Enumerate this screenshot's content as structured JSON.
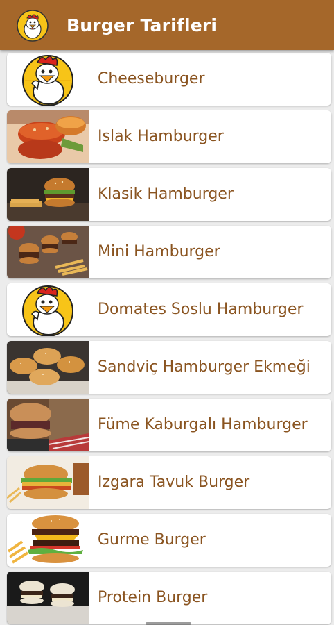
{
  "app": {
    "title": "Burger Tarifleri",
    "logo_icon": "chicken-chef-logo-icon",
    "bar_color": "#a5672a",
    "text_color": "#8a5420"
  },
  "recipes": [
    {
      "label": "Cheeseburger",
      "thumb": "chicken-chef-logo"
    },
    {
      "label": "Islak Hamburger",
      "thumb": "wet-burger-photo"
    },
    {
      "label": "Klasik Hamburger",
      "thumb": "classic-burger-photo"
    },
    {
      "label": "Mini Hamburger",
      "thumb": "mini-burgers-photo"
    },
    {
      "label": "Domates Soslu Hamburger",
      "thumb": "chicken-chef-logo"
    },
    {
      "label": "Sandviç Hamburger Ekmeği",
      "thumb": "burger-buns-photo"
    },
    {
      "label": "Füme Kaburgalı Hamburger",
      "thumb": "smoked-rib-burger-photo"
    },
    {
      "label": "Izgara Tavuk Burger",
      "thumb": "grilled-chicken-burger-photo"
    },
    {
      "label": "Gurme Burger",
      "thumb": "gourmet-burger-photo"
    },
    {
      "label": "Protein Burger",
      "thumb": "protein-burger-photo"
    }
  ]
}
